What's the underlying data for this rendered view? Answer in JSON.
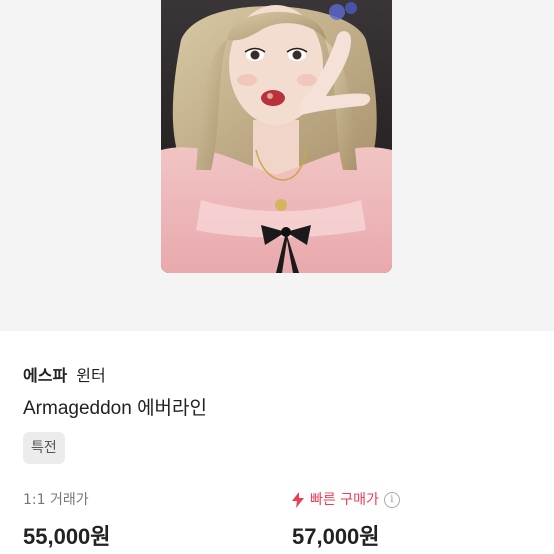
{
  "product": {
    "group": "에스파",
    "member": "윈터",
    "title": "Armageddon 에버라인",
    "tag": "특전"
  },
  "prices": {
    "trade_label": "1:1 거래가",
    "trade_value": "55,000원",
    "fast_label": "빠른 구매가",
    "fast_value": "57,000원",
    "fast_icon": "lightning-icon",
    "info_icon": "info-icon"
  },
  "colors": {
    "fast_accent": "#ef3b55",
    "hero_bg": "#f4f4f4"
  }
}
